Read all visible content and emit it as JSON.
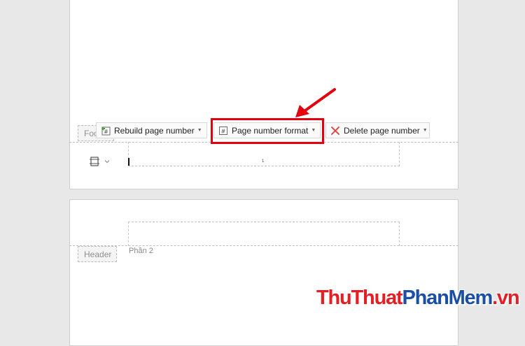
{
  "footer": {
    "tag_label": "Footer",
    "toolbar": {
      "rebuild_label": "Rebuild page number",
      "format_label": "Page number format",
      "delete_label": "Delete page number"
    },
    "page_number": "1"
  },
  "header": {
    "tag_label": "Header",
    "section_label": "Phần 2"
  },
  "watermark": {
    "part1": "ThuThuat",
    "part2": "PhanMem",
    "part3": ".vn"
  },
  "colors": {
    "highlight": "#e3000f",
    "delete_icon": "#e53935",
    "watermark_red": "#e31e24",
    "watermark_blue": "#1a4fa3"
  }
}
